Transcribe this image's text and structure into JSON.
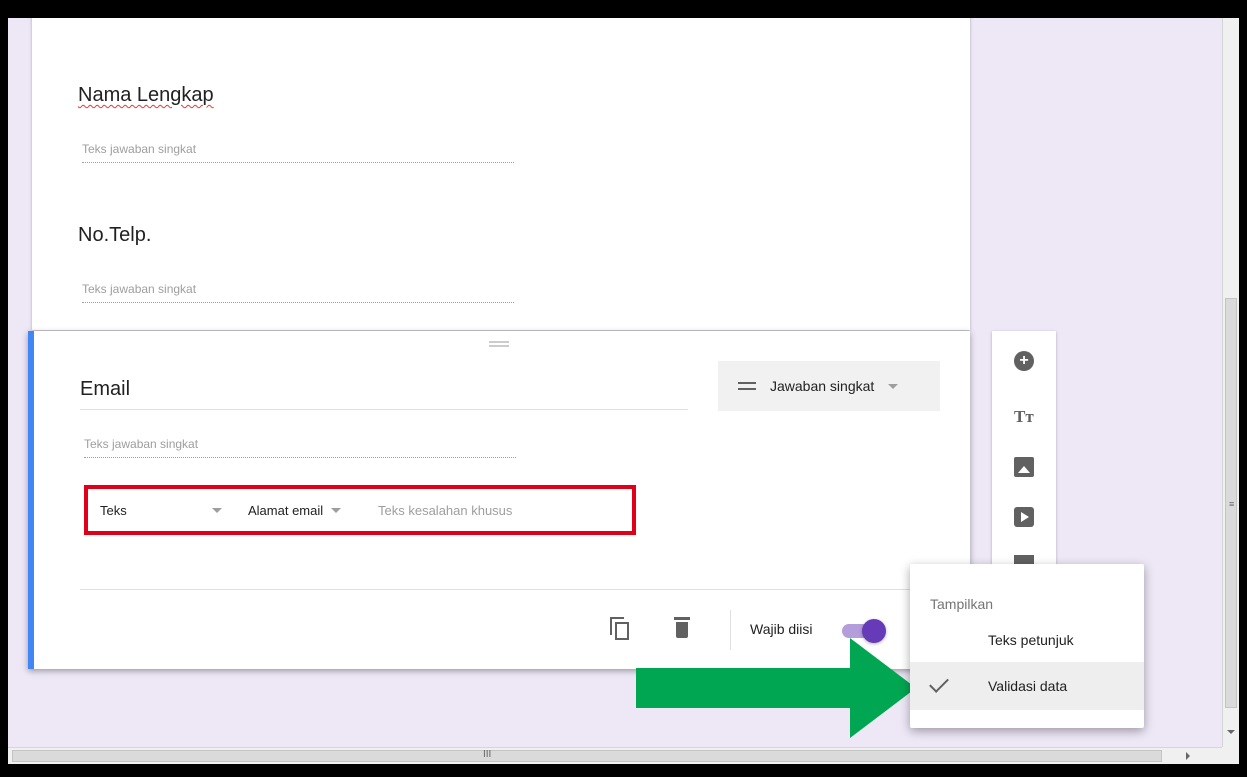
{
  "questions": [
    {
      "title": "Nama Lengkap",
      "placeholder": "Teks jawaban singkat"
    },
    {
      "title": "No.Telp.",
      "placeholder": "Teks jawaban singkat"
    }
  ],
  "active_question": {
    "title": "Email",
    "placeholder": "Teks jawaban singkat",
    "type_label": "Jawaban singkat",
    "validation": {
      "type": "Teks",
      "condition": "Alamat email",
      "error_placeholder": "Teks kesalahan khusus"
    },
    "required_label": "Wajib diisi",
    "required_on": true
  },
  "menu": {
    "header": "Tampilkan",
    "items": [
      {
        "label": "Teks petunjuk",
        "checked": false
      },
      {
        "label": "Validasi data",
        "checked": true
      }
    ]
  },
  "toolbar_icons": [
    "add-question-icon",
    "add-title-icon",
    "add-image-icon",
    "add-video-icon",
    "add-section-icon"
  ],
  "colors": {
    "accent": "#673ab7",
    "active_border": "#4285f4",
    "highlight_box": "#e0001a",
    "arrow": "#00a651",
    "background": "#ede7f6"
  }
}
